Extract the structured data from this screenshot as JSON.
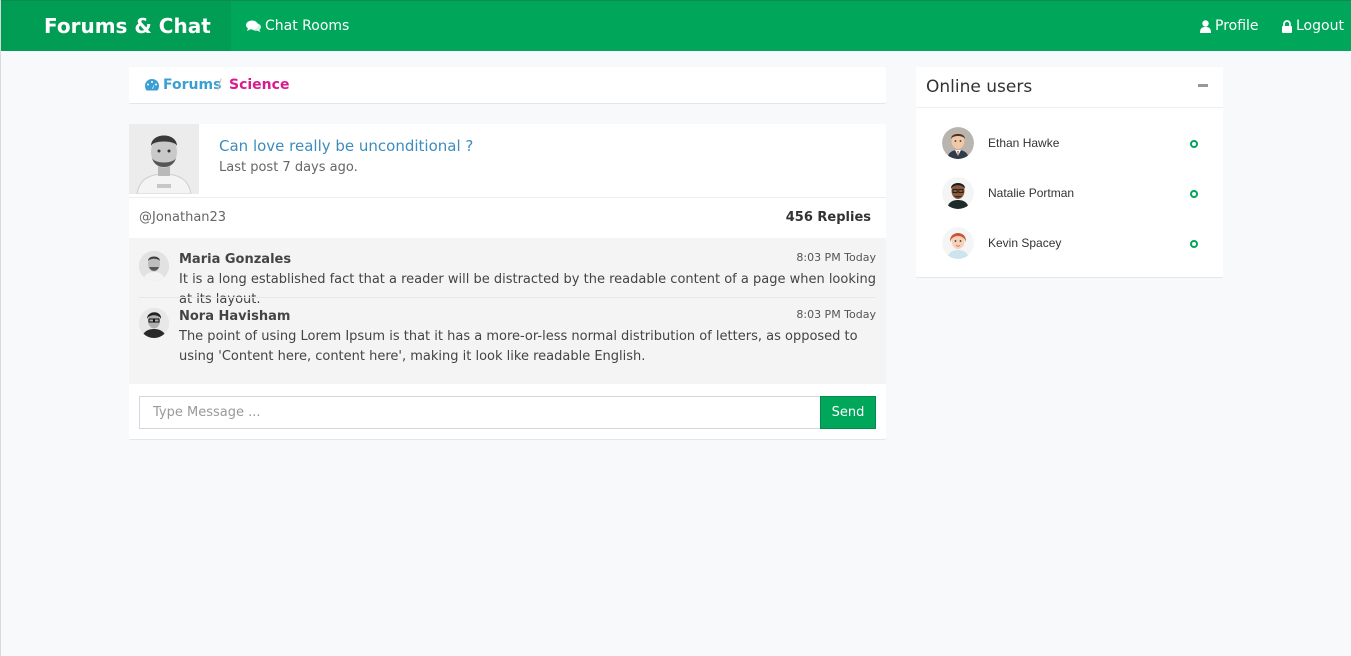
{
  "navbar": {
    "brand": "Forums & Chat",
    "chat_rooms": "Chat Rooms",
    "profile": "Profile",
    "logout": "Logout",
    "icons": [
      "chat-bubbles-icon",
      "user-icon",
      "lock-icon"
    ],
    "color": "#00a65a"
  },
  "breadcrumb": {
    "forums": "Forums",
    "separator": "/",
    "current": "Science",
    "forums_color": "#3c9fd3",
    "current_color": "#d81b8f"
  },
  "thread": {
    "title": "Can love really be unconditional ?",
    "meta": "Last post 7 days ago.",
    "author": "@Jonathan23",
    "replies": "456 Replies"
  },
  "messages": [
    {
      "name": "Maria Gonzales",
      "time": "8:03 PM Today",
      "text": "It is a long established fact that a reader will be distracted by the readable content of a page when looking at its layout."
    },
    {
      "name": "Nora Havisham",
      "time": "8:03 PM Today",
      "text": "The point of using Lorem Ipsum is that it has a more-or-less normal distribution of letters, as opposed to using 'Content here, content here', making it look like readable English."
    }
  ],
  "composer": {
    "placeholder": "Type Message ...",
    "send": "Send"
  },
  "online": {
    "title": "Online users",
    "users": [
      {
        "name": "Ethan Hawke",
        "status": "online"
      },
      {
        "name": "Natalie Portman",
        "status": "online"
      },
      {
        "name": "Kevin Spacey",
        "status": "online"
      }
    ],
    "status_color": "#00a65a"
  }
}
